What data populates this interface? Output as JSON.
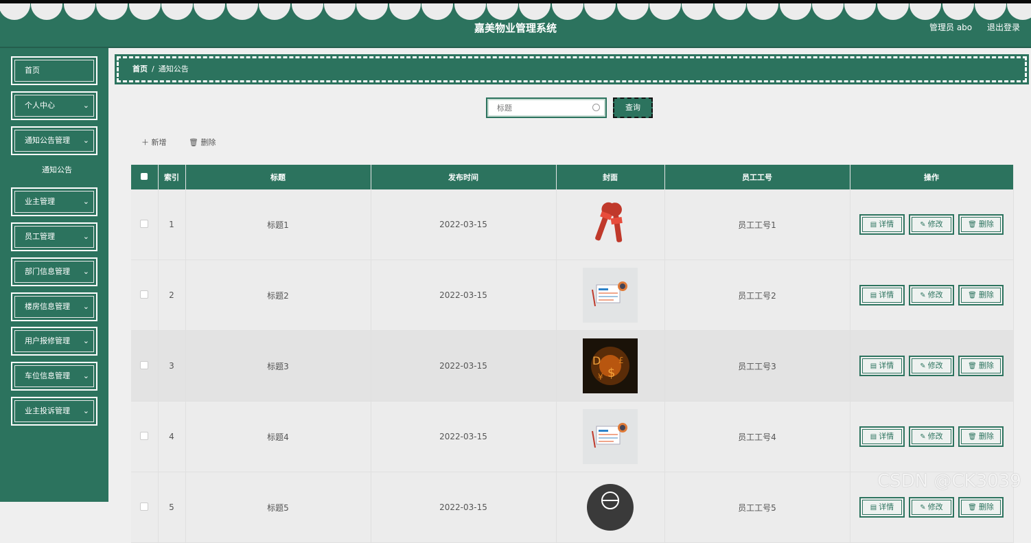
{
  "header": {
    "title": "嘉美物业管理系统",
    "user": "管理员 abo",
    "logout": "退出登录"
  },
  "sidebar": {
    "items": [
      {
        "label": "首页"
      },
      {
        "label": "个人中心"
      },
      {
        "label": "通知公告管理"
      },
      {
        "label": "通知公告"
      },
      {
        "label": "业主管理"
      },
      {
        "label": "员工管理"
      },
      {
        "label": "部门信息管理"
      },
      {
        "label": "楼房信息管理"
      },
      {
        "label": "用户报修管理"
      },
      {
        "label": "车位信息管理"
      },
      {
        "label": "业主投诉管理"
      }
    ]
  },
  "breadcrumb": {
    "home": "首页",
    "separator": "/",
    "current": "通知公告"
  },
  "search": {
    "placeholder": "标题",
    "button": "查询"
  },
  "toolbar": {
    "add": "新增",
    "delete": "删除"
  },
  "table": {
    "headers": [
      "索引",
      "标题",
      "发布时间",
      "封面",
      "员工工号",
      "操作"
    ],
    "rows": [
      {
        "index": "1",
        "title": "标题1",
        "date": "2022-03-15",
        "cover": "microphone-news-live-icon",
        "staff": "员工工号1"
      },
      {
        "index": "2",
        "title": "标题2",
        "date": "2022-03-15",
        "cover": "newspaper-news-icon",
        "staff": "员工工号2"
      },
      {
        "index": "3",
        "title": "标题3",
        "date": "2022-03-15",
        "cover": "dollar-fire-icon",
        "staff": "员工工号3"
      },
      {
        "index": "4",
        "title": "标题4",
        "date": "2022-03-15",
        "cover": "newspaper-news-icon",
        "staff": "员工工号4"
      },
      {
        "index": "5",
        "title": "标题5",
        "date": "2022-03-15",
        "cover": "globe-news-badge-icon",
        "staff": "员工工号5"
      }
    ],
    "actions": {
      "detail": "详情",
      "edit": "修改",
      "delete": "删除"
    }
  },
  "watermark": "CSDN @CK3039",
  "colors": {
    "primary": "#2c735e",
    "background": "#efefef"
  }
}
